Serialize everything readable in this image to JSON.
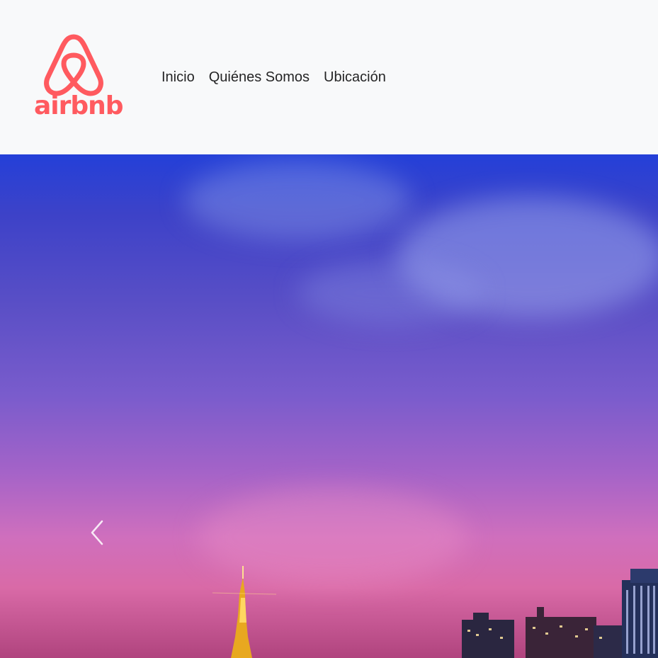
{
  "navbar": {
    "brand": {
      "logo_icon": "airbnb-belo-icon",
      "wordmark": "airbnb",
      "color": "#ff5a5f"
    },
    "links": [
      {
        "label": "Inicio"
      },
      {
        "label": "Quiénes Somos"
      },
      {
        "label": "Ubicación"
      }
    ],
    "background": "#f8f9fa"
  },
  "carousel": {
    "slide_description_icon": "paris-eiffel-tower-dusk-image",
    "prev_icon": "chevron-left-icon",
    "sky_colors": [
      "#2440d8",
      "#7a5ccc",
      "#cf6fbd",
      "#b0447e"
    ]
  }
}
